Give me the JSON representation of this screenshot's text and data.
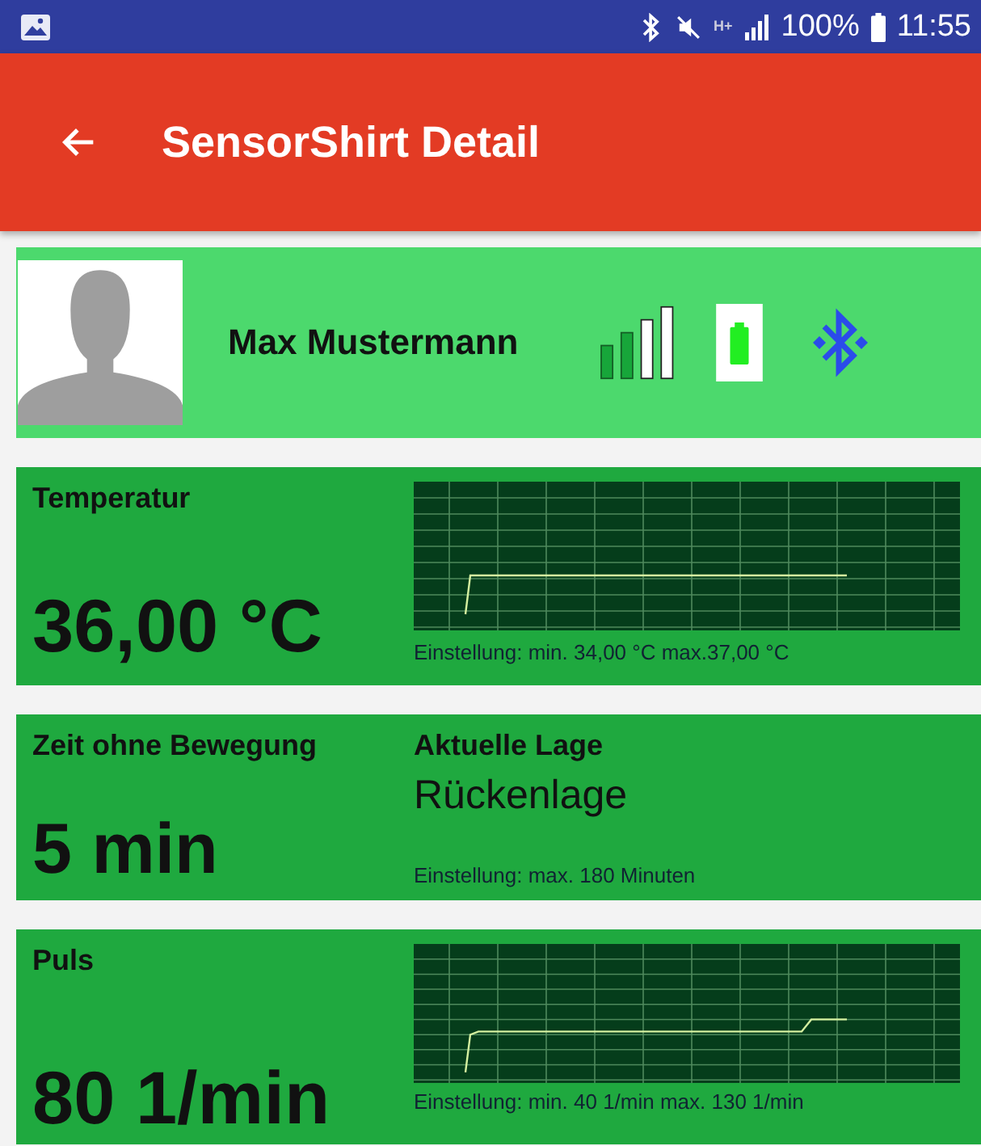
{
  "status_bar": {
    "network": "H+",
    "battery": "100%",
    "time": "11:55"
  },
  "app_bar": {
    "title": "SensorShirt Detail"
  },
  "profile": {
    "name": "Max Mustermann"
  },
  "cards": [
    {
      "kind": "chart",
      "label": "Temperatur",
      "value": "36,00 °C",
      "setting": "Einstellung: min. 34,00 °C  max.37,00 °C"
    },
    {
      "kind": "split",
      "label": "Zeit ohne Bewegung",
      "value": "5 min",
      "secondary_label": "Aktuelle Lage",
      "secondary_value": "Rückenlage",
      "setting": "Einstellung: max. 180 Minuten"
    },
    {
      "kind": "chart",
      "label": "Puls",
      "value": "80 1/min",
      "setting": "Einstellung: min. 40 1/min max. 130 1/min"
    }
  ]
}
